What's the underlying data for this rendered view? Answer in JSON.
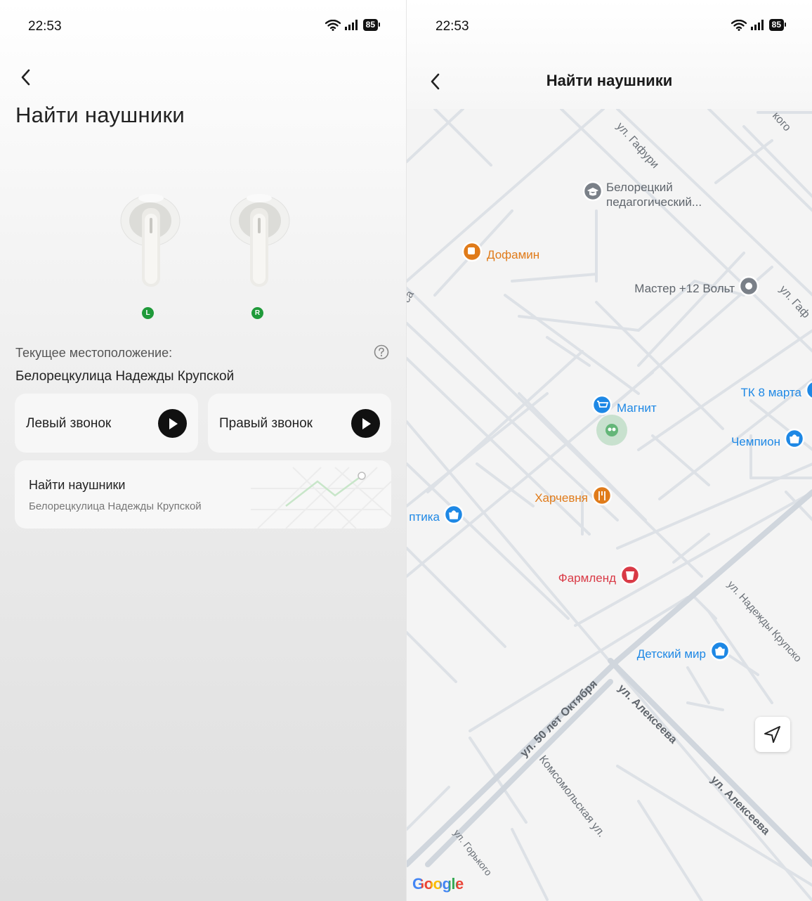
{
  "left_screen": {
    "status": {
      "time": "22:53",
      "battery": "85"
    },
    "title": "Найти наушники",
    "earbuds": {
      "left_badge": "L",
      "right_badge": "R"
    },
    "location_label": "Текущее местоположение:",
    "location_value": "Белорецкулица Надежды Крупской",
    "ring_left_label": "Левый звонок",
    "ring_right_label": "Правый звонок",
    "find_card": {
      "title": "Найти наушники",
      "subtitle": "Белорецкулица Надежды Крупской"
    }
  },
  "right_screen": {
    "status": {
      "time": "22:53",
      "battery": "85"
    },
    "title": "Найти наушники",
    "map": {
      "streets": {
        "gafuri_top": "ул. Гафури",
        "gafuri_right": "ул. Гаф",
        "kogo": "кого",
        "sa": "са",
        "krupskoy": "ул. Надежды Крупско",
        "oktyabrya": "ул. 50 лет Октября",
        "alekseeva1": "ул. Алексеева",
        "alekseeva2": "ул. Алексеева",
        "komsomolskaya": "Комсомольская ул.",
        "gorkogo": "ул. Горького"
      },
      "places": {
        "pedagog_line1": "Белорецкий",
        "pedagog_line2": "педагогический...",
        "dofamin": "Дофамин",
        "master": "Мастер +12 Вольт",
        "tk": "ТК 8 марта",
        "magnit": "Магнит",
        "chempion": "Чемпион",
        "kharchevnya": "Харчевня",
        "optika": "птика",
        "farmlend": "Фармленд",
        "detsky_mir": "Детский мир"
      },
      "colors": {
        "orange": "#e07b1a",
        "blue": "#1e88e5",
        "red": "#d93a46",
        "gray": "#7a8088",
        "marker_green": "#2e9e4a"
      }
    },
    "google_logo": "Google"
  }
}
